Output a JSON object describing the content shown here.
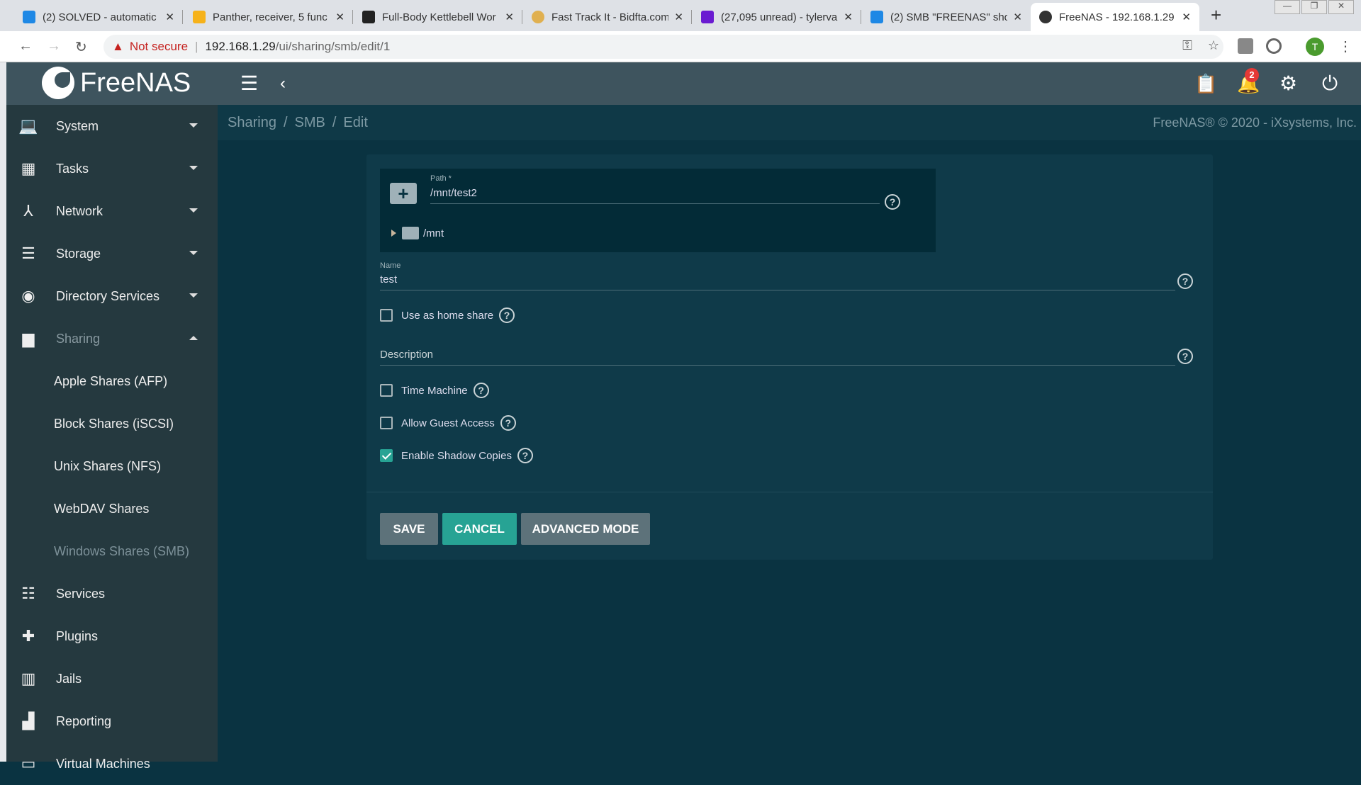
{
  "browser": {
    "tabs": [
      {
        "title": "(2) SOLVED - automatic",
        "color": "#1e88e5"
      },
      {
        "title": "Panther, receiver, 5 func",
        "color": "#f6b21a"
      },
      {
        "title": "Full-Body Kettlebell Wor",
        "color": "#222222"
      },
      {
        "title": "Fast Track It - Bidfta.com",
        "color": "#e0b050"
      },
      {
        "title": "(27,095 unread) - tylerva",
        "color": "#6a1bd1"
      },
      {
        "title": "(2) SMB \"FREENAS\" sho",
        "color": "#1e88e5"
      },
      {
        "title": "FreeNAS - 192.168.1.29",
        "color": "#333333"
      }
    ],
    "new_tab": "+",
    "security": "Not secure",
    "url_host": "192.168.1.29",
    "url_path": "/ui/sharing/smb/edit/1",
    "profile_initial": "T"
  },
  "app": {
    "logo": "FreeNAS",
    "notification_count": "2"
  },
  "sidebar": {
    "items": [
      {
        "label": "System",
        "icon": "laptop-icon",
        "caret": "down"
      },
      {
        "label": "Tasks",
        "icon": "calendar-icon",
        "caret": "down"
      },
      {
        "label": "Network",
        "icon": "network-icon",
        "caret": "down"
      },
      {
        "label": "Storage",
        "icon": "storage-icon",
        "caret": "down"
      },
      {
        "label": "Directory Services",
        "icon": "directory-icon",
        "caret": "down"
      },
      {
        "label": "Sharing",
        "icon": "folder-shared-icon",
        "caret": "up"
      }
    ],
    "sub_items": [
      "Apple Shares (AFP)",
      "Block Shares (iSCSI)",
      "Unix Shares (NFS)",
      "WebDAV Shares",
      "Windows Shares (SMB)"
    ],
    "bottom_items": [
      {
        "label": "Services",
        "icon": "tune-icon"
      },
      {
        "label": "Plugins",
        "icon": "puzzle-icon"
      },
      {
        "label": "Jails",
        "icon": "jail-icon"
      },
      {
        "label": "Reporting",
        "icon": "chart-icon"
      },
      {
        "label": "Virtual Machines",
        "icon": "vm-icon"
      }
    ]
  },
  "breadcrumb": [
    "Sharing",
    "SMB",
    "Edit"
  ],
  "copyright": "FreeNAS® © 2020 - iXsystems, Inc.",
  "form": {
    "path_label": "Path *",
    "path_value": "/mnt/test2",
    "tree_root": "/mnt",
    "name_label": "Name",
    "name_value": "test",
    "home_share_label": "Use as home share",
    "home_share": false,
    "description_label": "Description",
    "description_value": "",
    "time_machine_label": "Time Machine",
    "time_machine": false,
    "guest_label": "Allow Guest Access",
    "guest": false,
    "shadow_label": "Enable Shadow Copies",
    "shadow": true,
    "help": "?"
  },
  "buttons": {
    "save": "SAVE",
    "cancel": "CANCEL",
    "advanced": "ADVANCED MODE"
  },
  "colors": {
    "accent": "#27a394",
    "header": "#3e545e",
    "sidebar": "#25393f",
    "content": "#0a3341"
  }
}
